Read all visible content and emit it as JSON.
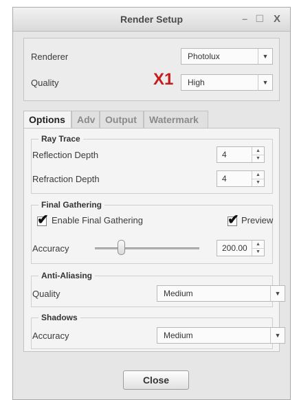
{
  "window": {
    "title": "Render Setup",
    "controls": {
      "minimize": "–",
      "maximize": "☐",
      "close": "X"
    }
  },
  "top": {
    "renderer_label": "Renderer",
    "renderer_value": "Photolux",
    "quality_label": "Quality",
    "quality_value": "High",
    "annotation": "X1"
  },
  "tabs": [
    "Options",
    "Adv",
    "Output",
    "Watermark"
  ],
  "ray_trace": {
    "legend": "Ray Trace",
    "reflection_label": "Reflection Depth",
    "reflection_value": "4",
    "refraction_label": "Refraction Depth",
    "refraction_value": "4"
  },
  "final_gathering": {
    "legend": "Final Gathering",
    "enable_label": "Enable Final Gathering",
    "enable_checked": true,
    "preview_label": "Preview",
    "preview_checked": true,
    "accuracy_label": "Accuracy",
    "accuracy_value": "200.00",
    "accuracy_slider_fraction": 0.25
  },
  "anti_aliasing": {
    "legend": "Anti-Aliasing",
    "quality_label": "Quality",
    "quality_value": "Medium"
  },
  "shadows": {
    "legend": "Shadows",
    "accuracy_label": "Accuracy",
    "accuracy_value": "Medium"
  },
  "footer": {
    "close_label": "Close"
  },
  "icons": {
    "dropdown": "▼",
    "spin_up": "▲",
    "spin_down": "▼",
    "checkmark": "✔"
  }
}
